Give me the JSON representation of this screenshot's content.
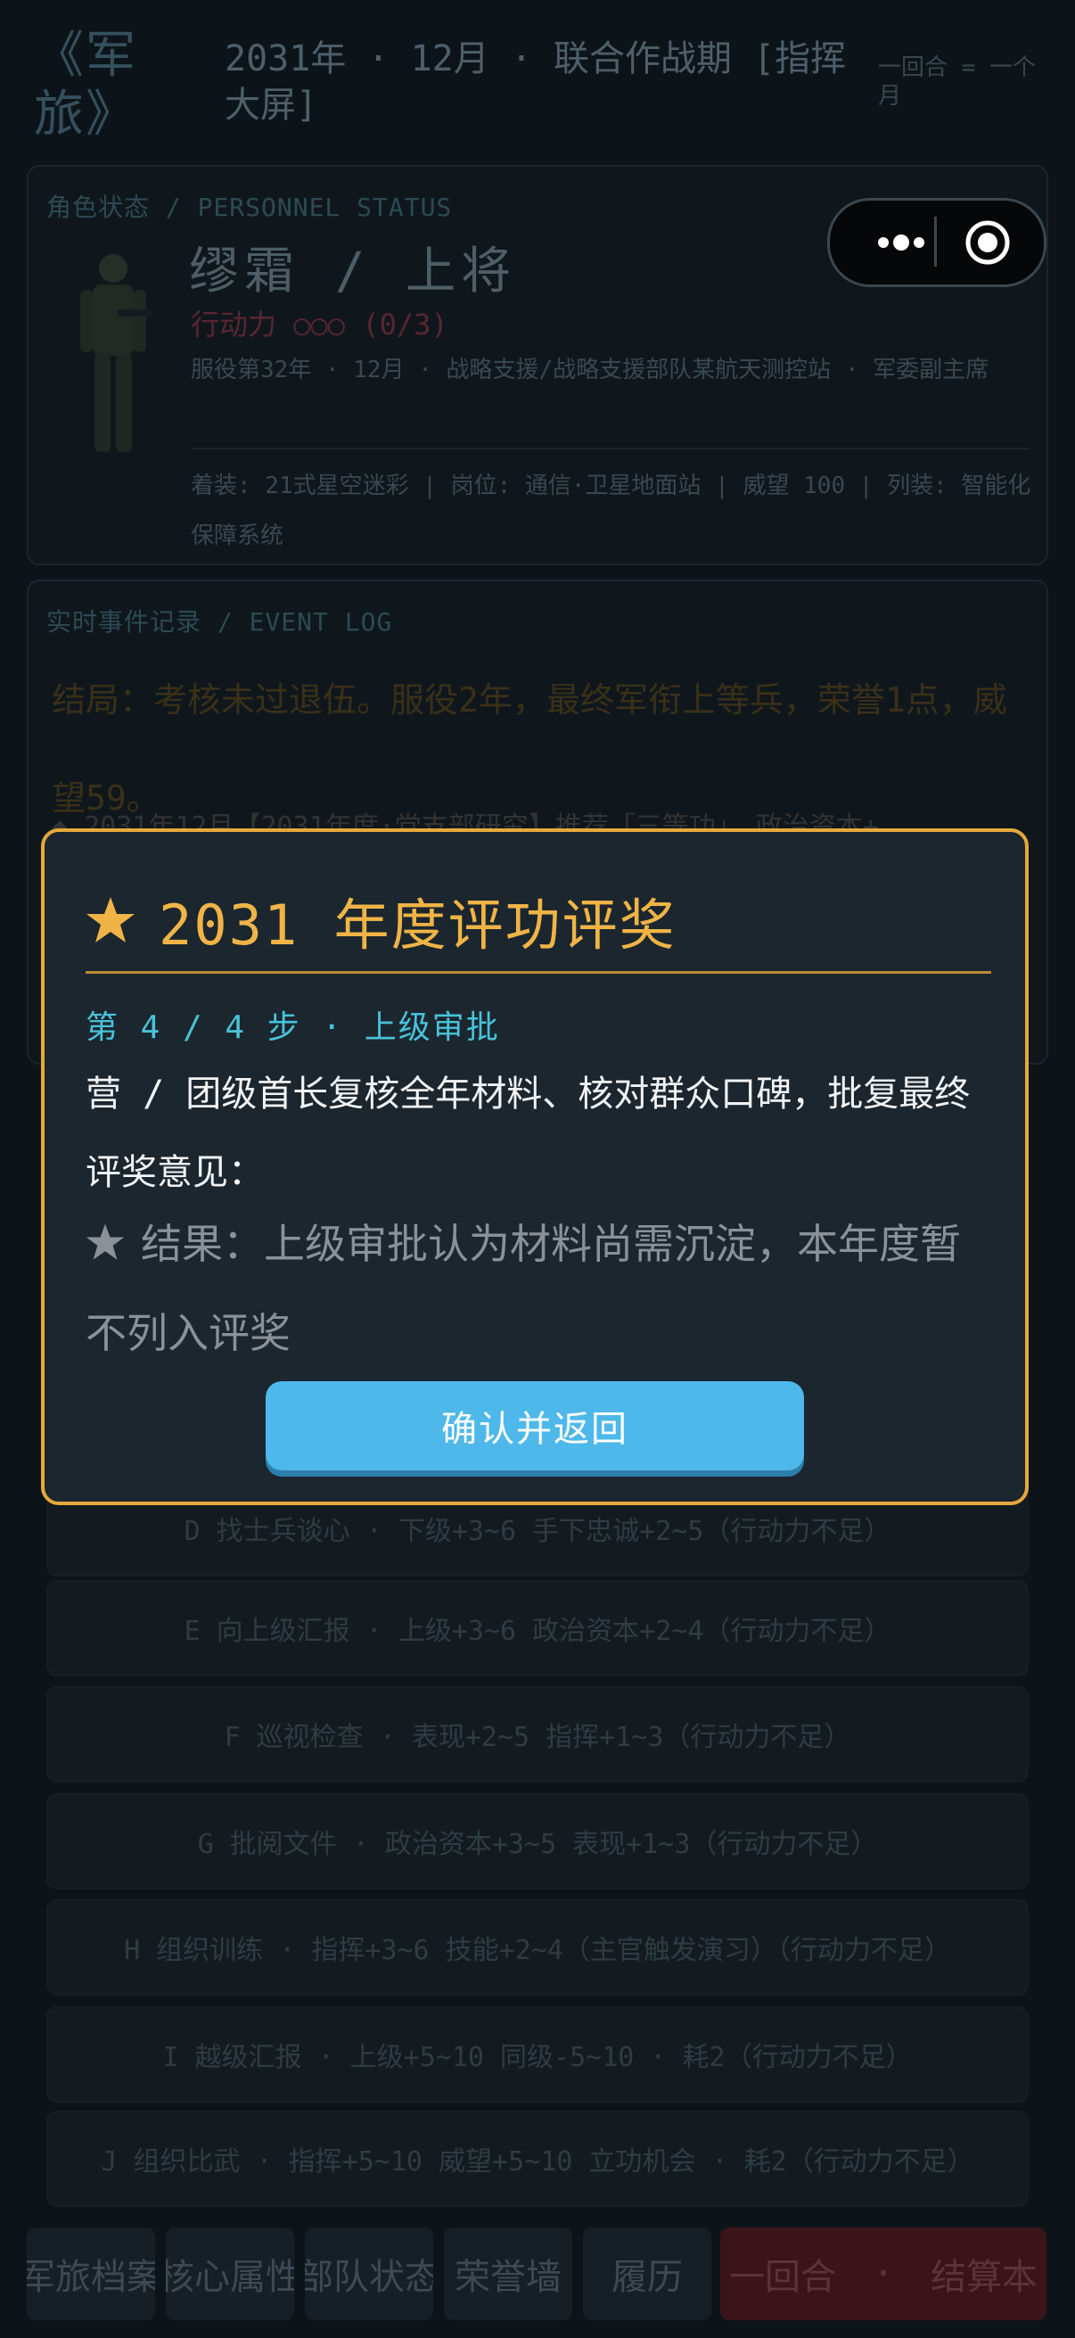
{
  "header": {
    "app_title": "《军旅》",
    "subtitle": "2031年 · 12月 · 联合作战期 [指挥大屏]",
    "turn_note": "一回合 = 一个月"
  },
  "personnel": {
    "panel_label": "角色状态 / PERSONNEL STATUS",
    "name_rank": "缪霜 / 上将",
    "action_points": "行动力 ○○○ (0/3)",
    "service_info": "服役第32年 · 12月 · 战略支援/战略支援部队某航天测控站 · 军委副主席",
    "equipment_info": "着装: 21式星空迷彩 | 岗位: 通信·卫星地面站 | 威望 100 | 列装: 智能化保障系统"
  },
  "event_log": {
    "panel_label": "实时事件记录 / EVENT LOG",
    "main_event": "结局：考核未过退伍。服役2年，最终军衔上等兵，荣誉1点，威望59。",
    "entry": "◆ 2031年12月【2031年度·党支部研究】推荐「三等功」，政治资本+"
  },
  "actions": [
    "D  找士兵谈心 · 下级+3~6 手下忠诚+2~5（行动力不足）",
    "E  向上级汇报 · 上级+3~6 政治资本+2~4（行动力不足）",
    "F  巡视检查 · 表现+2~5 指挥+1~3（行动力不足）",
    "G  批阅文件 · 政治资本+3~5 表现+1~3（行动力不足）",
    "H  组织训练 · 指挥+3~6 技能+2~4（主官触发演习）（行动力不足）",
    "I  越级汇报 · 上级+5~10 同级-5~10 · 耗2（行动力不足）",
    "J  组织比武 · 指挥+5~10 威望+5~10 立功机会 · 耗2（行动力不足）"
  ],
  "bottom_nav": {
    "items": [
      "军旅档案",
      "核心属性",
      "部队状态",
      "荣誉墙",
      "履历"
    ],
    "end_turn_left": "一回合",
    "end_turn_dot": "·",
    "end_turn_right": "结算本"
  },
  "modal": {
    "title": "2031 年度评功评奖",
    "step": "第 4 / 4 步 · 上级审批",
    "description": "营 / 团级首长复核全年材料、核对群众口碑，批复最终评奖意见：",
    "result": "结果：上级审批认为材料尚需沉淀，本年度暂不列入评奖",
    "confirm_label": "确认并返回"
  },
  "colors": {
    "accent_gold": "#e6a93b",
    "step_cyan": "#49c2d8",
    "button_blue": "#4fb8ea",
    "background": "#0d1419"
  },
  "icons": [
    "more-dots-icon",
    "close-target-icon",
    "soldier-avatar",
    "star-icon"
  ]
}
